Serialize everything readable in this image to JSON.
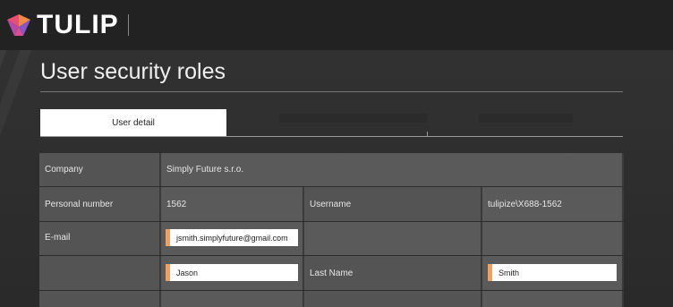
{
  "header": {
    "logo_text": "TULIP"
  },
  "page": {
    "title": "User security roles"
  },
  "tabs": [
    {
      "label": "User detail",
      "active": true
    }
  ],
  "form": {
    "company": {
      "label": "Company",
      "value": "Simply Future s.r.o."
    },
    "personal_number": {
      "label": "Personal number",
      "value": "1562"
    },
    "username": {
      "label": "Username",
      "value": "tulipize\\X688-1562"
    },
    "email": {
      "label": "E-mail",
      "value": "jsmith.simplyfuture@gmail.com"
    },
    "first_name": {
      "label": "",
      "value": "Jason"
    },
    "last_name": {
      "label": "Last Name",
      "value": "Smith"
    }
  },
  "colors": {
    "accent": "#f0a060",
    "header_bg": "#222222",
    "cell_bg": "#5a5a5a"
  }
}
